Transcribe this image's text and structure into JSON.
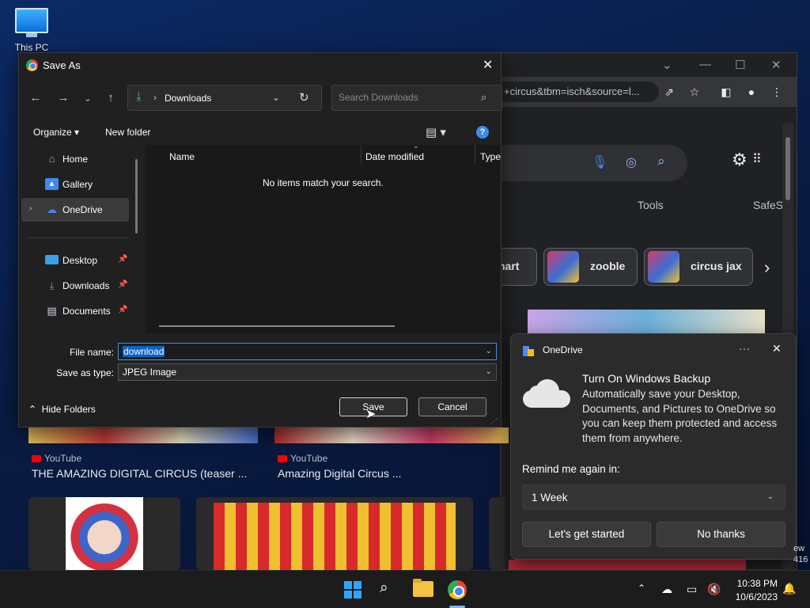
{
  "desktop": {
    "icon_label": "This PC",
    "edge_text_1": "ew",
    "edge_text_2": "416"
  },
  "chrome": {
    "url_fragment": "+circus&tbm=isch&source=l...",
    "tools_label": "Tools",
    "safesearch_label": "SafeS",
    "chips": [
      {
        "label": "nart"
      },
      {
        "label": "zooble"
      },
      {
        "label": "circus jax"
      }
    ],
    "results": [
      {
        "source": "YouTube",
        "title": "THE AMAZING DIGITAL CIRCUS (teaser ..."
      },
      {
        "source": "YouTube",
        "title": "Amazing Digital Circus ..."
      }
    ]
  },
  "dialog": {
    "title": "Save As",
    "address": {
      "path": "Downloads"
    },
    "search": {
      "placeholder": "Search Downloads"
    },
    "toolbar": {
      "organize": "Organize",
      "new_folder": "New folder"
    },
    "nav": {
      "items": [
        {
          "label": "Home"
        },
        {
          "label": "Gallery"
        },
        {
          "label": "OneDrive"
        },
        {
          "label": "Desktop"
        },
        {
          "label": "Downloads"
        },
        {
          "label": "Documents"
        }
      ]
    },
    "columns": [
      "Name",
      "Date modified",
      "Type"
    ],
    "empty_message": "No items match your search.",
    "form": {
      "file_name_label": "File name:",
      "file_name_value": "download",
      "save_type_label": "Save as type:",
      "save_type_value": "JPEG Image"
    },
    "hide_folders": "Hide Folders",
    "save_label": "Save",
    "cancel_label": "Cancel"
  },
  "onedrive": {
    "title": "OneDrive",
    "heading": "Turn On Windows Backup",
    "body": "Automatically save your Desktop, Documents, and Pictures to OneDrive so you can keep them protected and access them from anywhere.",
    "remind_label": "Remind me again in:",
    "remind_value": "1 Week",
    "start_label": "Let's get started",
    "no_thanks_label": "No thanks"
  },
  "taskbar": {
    "time": "10:38 PM",
    "date": "10/6/2023"
  },
  "colors": {
    "accent": "#0a64c8",
    "taskbar": "#1c1c1c",
    "dialog_bg": "#202020"
  }
}
